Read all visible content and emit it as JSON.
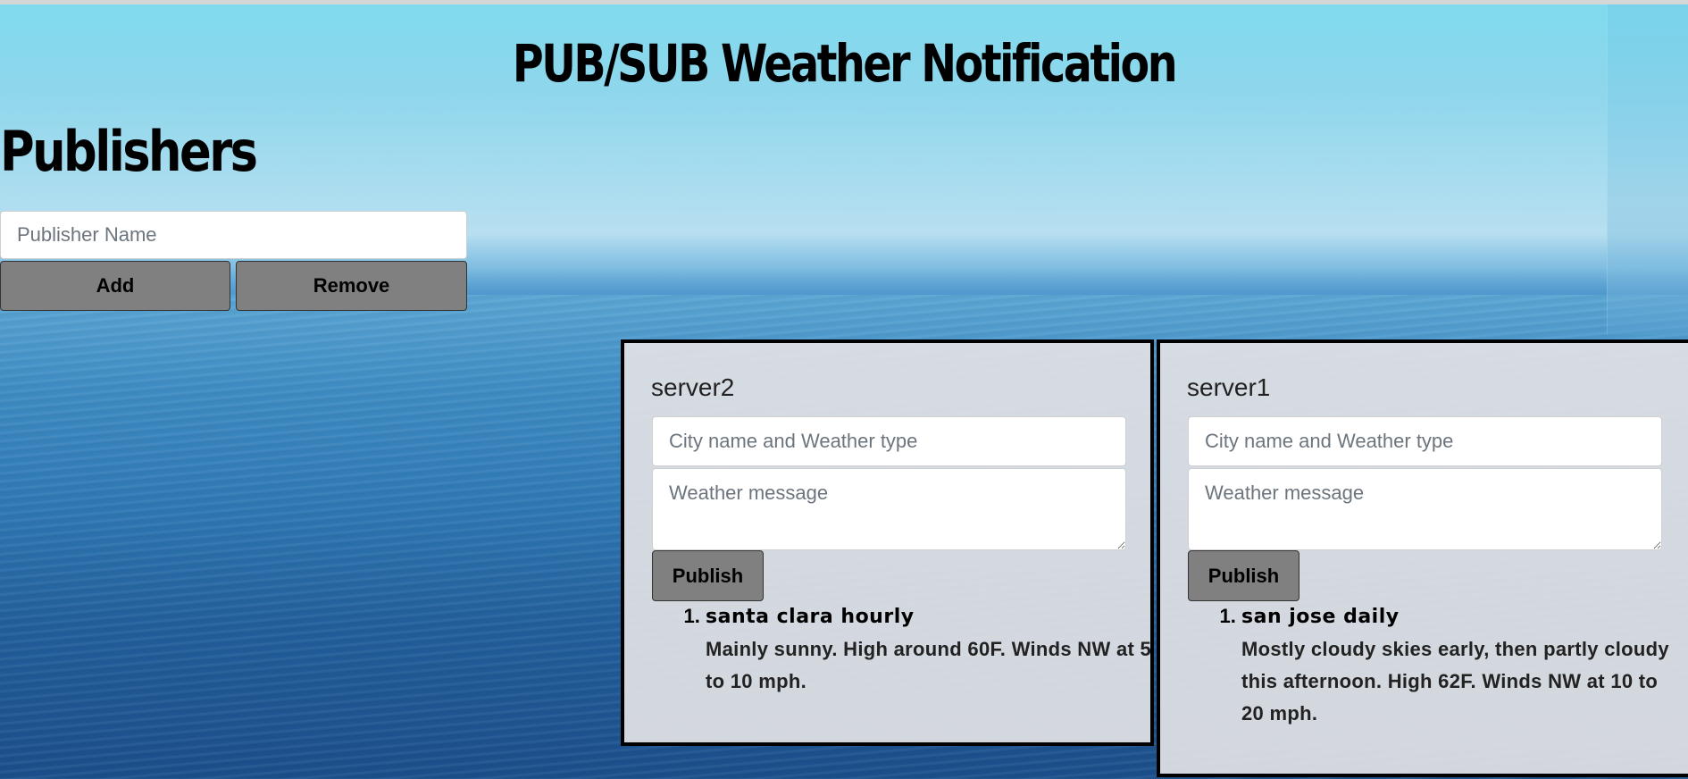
{
  "header": {
    "title": "PUB/SUB Weather Notification"
  },
  "publishers": {
    "heading": "Publishers",
    "name_placeholder": "Publisher Name",
    "add_label": "Add",
    "remove_label": "Remove"
  },
  "servers": [
    {
      "name": "server2",
      "city_placeholder": "City name and Weather type",
      "message_placeholder": "Weather message",
      "publish_label": "Publish",
      "messages": [
        {
          "title": "santa clara hourly",
          "body": "Mainly sunny. High around 60F. Winds NW at 5 to 10 mph."
        }
      ]
    },
    {
      "name": "server1",
      "city_placeholder": "City name and Weather type",
      "message_placeholder": "Weather message",
      "publish_label": "Publish",
      "messages": [
        {
          "title": "san jose daily",
          "body": "Mostly cloudy skies early, then partly cloudy this afternoon. High 62F. Winds NW at 10 to 20 mph."
        }
      ]
    }
  ],
  "colors": {
    "button_gray": "#808080",
    "card_background": "#e1e1e4",
    "sky_top": "#7fdbee",
    "sea_deep": "#1b4f8b"
  }
}
